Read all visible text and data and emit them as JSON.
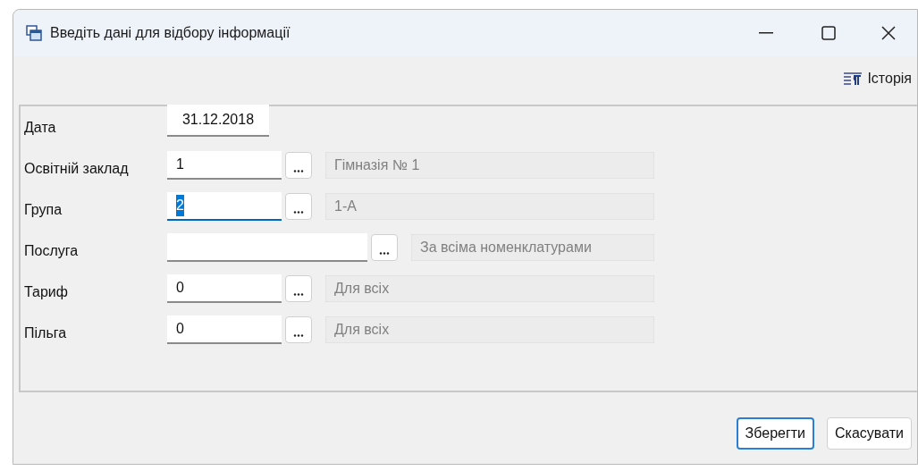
{
  "window": {
    "title": "Введіть дані для відбору інформації"
  },
  "toolbar": {
    "history_button": "Історія"
  },
  "fields": [
    {
      "kind": "date",
      "label": "Дата",
      "value": "31.12.2018",
      "focused": false
    },
    {
      "kind": "lookup",
      "label": "Освітній заклад",
      "value": "1",
      "focused": false,
      "display": "Гімназія № 1"
    },
    {
      "kind": "lookup",
      "label": "Група",
      "value": "2",
      "focused": true,
      "display": "1-А"
    },
    {
      "kind": "lookup_wide",
      "label": "Послуга",
      "focused": false,
      "display": "За всіма номенклатурами"
    },
    {
      "kind": "lookup",
      "label": "Тариф",
      "value": "0",
      "focused": false,
      "display": "Для всіх"
    },
    {
      "kind": "lookup",
      "label": "Пільга",
      "value": "0",
      "focused": false,
      "display": "Для всіх"
    }
  ],
  "buttons": [
    {
      "label": "Зберегти",
      "default": true
    },
    {
      "label": "Скасувати",
      "default": false
    }
  ]
}
